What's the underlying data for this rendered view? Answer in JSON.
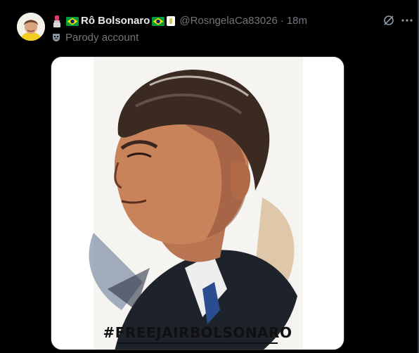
{
  "post": {
    "author": {
      "display_name": "Rô Bolsonaro",
      "handle": "@RosngelaCa83026",
      "time": "18m",
      "separator": "·",
      "badge": "Parody account",
      "emojis": [
        "lipstick-icon",
        "brazil-flag-icon",
        "brazil-flag-icon",
        "verified-document-icon"
      ]
    },
    "actions": {
      "grok_icon": "grok-icon",
      "more_icon": "more-icon"
    },
    "media": {
      "hashtag": "#FREEJAIRBOLSONARO"
    }
  },
  "colors": {
    "background": "#000000",
    "text_primary": "#e7e9ea",
    "text_secondary": "#71767b",
    "flag_green": "#009c3b",
    "flag_yellow": "#ffdf00",
    "flag_blue": "#002776"
  }
}
